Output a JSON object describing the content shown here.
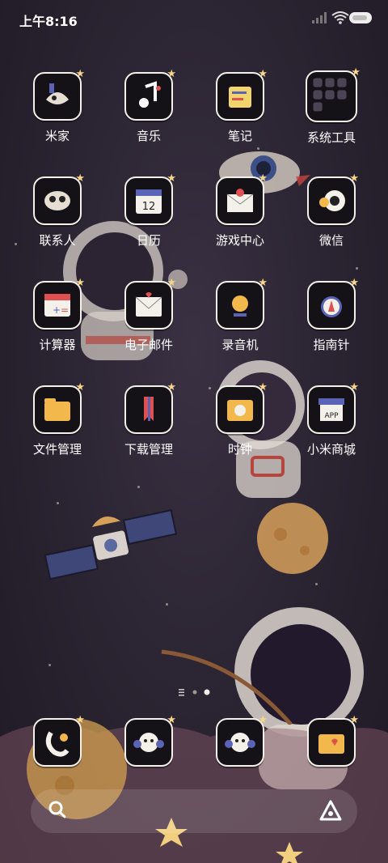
{
  "status_bar": {
    "time": "上午8:16"
  },
  "apps": [
    {
      "label": "米家",
      "icon": "mijia-icon"
    },
    {
      "label": "音乐",
      "icon": "music-icon"
    },
    {
      "label": "笔记",
      "icon": "notes-icon"
    },
    {
      "label": "系统工具",
      "icon": "system-tools-folder-icon"
    },
    {
      "label": "联系人",
      "icon": "contacts-icon"
    },
    {
      "label": "日历",
      "icon": "calendar-icon",
      "value": "12"
    },
    {
      "label": "游戏中心",
      "icon": "game-center-icon"
    },
    {
      "label": "微信",
      "icon": "wechat-icon"
    },
    {
      "label": "计算器",
      "icon": "calculator-icon"
    },
    {
      "label": "电子邮件",
      "icon": "email-icon"
    },
    {
      "label": "录音机",
      "icon": "recorder-icon"
    },
    {
      "label": "指南针",
      "icon": "compass-icon"
    },
    {
      "label": "文件管理",
      "icon": "file-manager-icon"
    },
    {
      "label": "下载管理",
      "icon": "download-manager-icon"
    },
    {
      "label": "时钟",
      "icon": "clock-icon"
    },
    {
      "label": "小米商城",
      "icon": "mi-store-icon",
      "value": "APP"
    }
  ],
  "dock": [
    {
      "icon": "phone-icon"
    },
    {
      "icon": "messages-icon"
    },
    {
      "icon": "browser-icon"
    },
    {
      "icon": "gallery-icon"
    }
  ],
  "colors": {
    "accent": "#f7d68a",
    "tile_bg": "#151217",
    "tile_border": "#f4f0ea"
  }
}
